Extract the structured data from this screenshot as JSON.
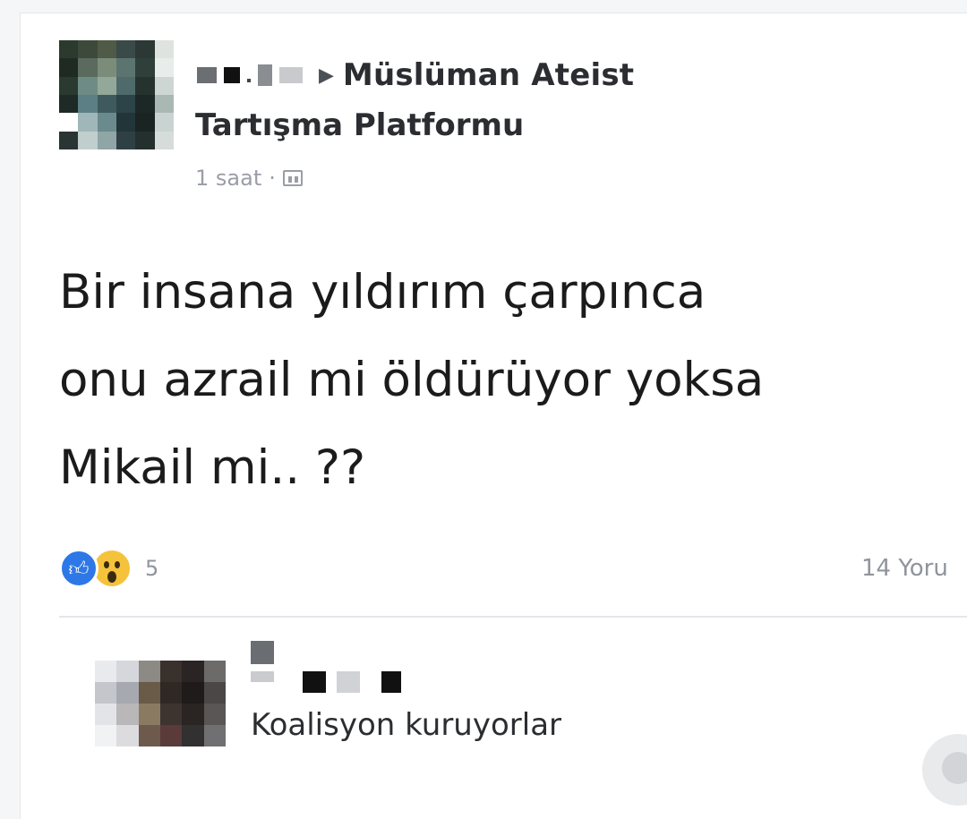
{
  "post": {
    "group_name_line1": "Müslüman Ateist",
    "group_name_line2": "Tartışma Platformu",
    "arrow_icon": "▶",
    "time": "1 saat",
    "separator": "·",
    "privacy_icon": "group-privacy-icon",
    "body": "Bir insana yıldırım çarpınca\nonu azrail mi öldürüyor yoksa\nMikail mi.. ??",
    "reactions": {
      "types": [
        "like",
        "wow"
      ],
      "count": "5"
    },
    "comment_count": "14 Yoru"
  },
  "comment": {
    "text": "Koalisyon kuruyorlar"
  },
  "colors": {
    "like_blue": "#2d78e6",
    "wow_yellow": "#f5c33b",
    "meta_gray": "#90949c"
  }
}
